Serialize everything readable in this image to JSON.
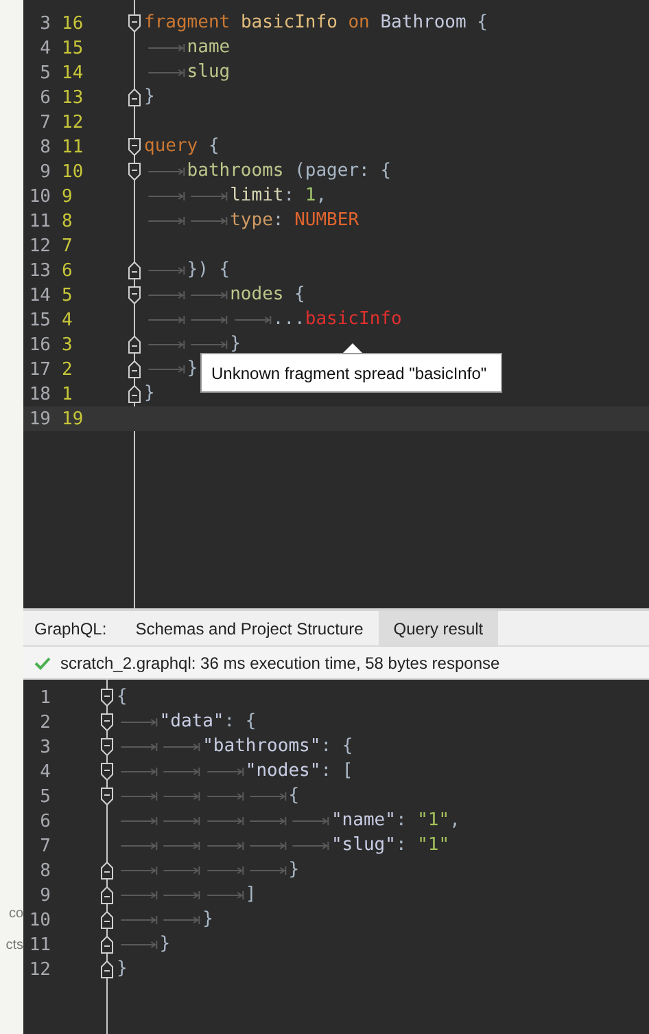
{
  "background_window": {
    "texts": [
      "co",
      "cts"
    ]
  },
  "query_editor": {
    "lines": [
      {
        "numbers": [
          "3",
          "16"
        ],
        "fold_start": true,
        "fold_end": false,
        "tokens": [
          {
            "kind": "keyword",
            "text": "fragment"
          },
          {
            "kind": "definition",
            "text": " basicInfo"
          },
          {
            "kind": "keyword",
            "text": " on"
          },
          {
            "kind": "type",
            "text": " Bathroom"
          },
          {
            "kind": "punct",
            "text": " {"
          }
        ]
      },
      {
        "numbers": [
          "4",
          "15"
        ],
        "fold_start": false,
        "fold_end": false,
        "tokens": [
          {
            "kind": "tab"
          },
          {
            "kind": "field",
            "text": "name"
          }
        ]
      },
      {
        "numbers": [
          "5",
          "14"
        ],
        "fold_start": false,
        "fold_end": false,
        "tokens": [
          {
            "kind": "tab"
          },
          {
            "kind": "field",
            "text": "slug"
          }
        ]
      },
      {
        "numbers": [
          "6",
          "13"
        ],
        "fold_start": false,
        "fold_end": true,
        "tokens": [
          {
            "kind": "punct",
            "text": "}"
          }
        ]
      },
      {
        "numbers": [
          "7",
          "12"
        ],
        "fold_start": false,
        "fold_end": false
      },
      {
        "numbers": [
          "8",
          "11"
        ],
        "fold_start": true,
        "fold_end": false,
        "tokens": [
          {
            "kind": "keyword",
            "text": "query"
          },
          {
            "kind": "punct",
            "text": " {"
          }
        ]
      },
      {
        "numbers": [
          "9",
          "10"
        ],
        "fold_start": true,
        "fold_end": false,
        "tokens": [
          {
            "kind": "tab"
          },
          {
            "kind": "field",
            "text": "bathrooms"
          },
          {
            "kind": "punct",
            "text": " (pager: {"
          }
        ]
      },
      {
        "numbers": [
          "10",
          "9"
        ],
        "fold_start": false,
        "fold_end": false,
        "tokens": [
          {
            "kind": "tab"
          },
          {
            "kind": "tab"
          },
          {
            "kind": "argument",
            "text": "limit"
          },
          {
            "kind": "punct",
            "text": ": "
          },
          {
            "kind": "number",
            "text": "1"
          },
          {
            "kind": "punct",
            "text": ","
          }
        ]
      },
      {
        "numbers": [
          "11",
          "8"
        ],
        "fold_start": false,
        "fold_end": false,
        "tokens": [
          {
            "kind": "tab"
          },
          {
            "kind": "tab"
          },
          {
            "kind": "argument2",
            "text": "type"
          },
          {
            "kind": "punct",
            "text": ": "
          },
          {
            "kind": "enum",
            "text": "NUMBER"
          }
        ]
      },
      {
        "numbers": [
          "12",
          "7"
        ],
        "fold_start": false,
        "fold_end": false
      },
      {
        "numbers": [
          "13",
          "6"
        ],
        "fold_start": false,
        "fold_end": true,
        "tokens": [
          {
            "kind": "tab"
          },
          {
            "kind": "punct",
            "text": "}) {"
          }
        ]
      },
      {
        "numbers": [
          "14",
          "5"
        ],
        "fold_start": true,
        "fold_end": false,
        "tokens": [
          {
            "kind": "tab"
          },
          {
            "kind": "tab"
          },
          {
            "kind": "field",
            "text": "nodes"
          },
          {
            "kind": "punct",
            "text": " {"
          }
        ]
      },
      {
        "numbers": [
          "15",
          "4"
        ],
        "fold_start": false,
        "fold_end": false,
        "tokens": [
          {
            "kind": "tab"
          },
          {
            "kind": "tab"
          },
          {
            "kind": "tab"
          },
          {
            "kind": "punct",
            "text": "..."
          },
          {
            "kind": "error",
            "text": "basicInfo"
          }
        ]
      },
      {
        "numbers": [
          "16",
          "3"
        ],
        "fold_start": false,
        "fold_end": true,
        "tokens": [
          {
            "kind": "tab"
          },
          {
            "kind": "tab"
          },
          {
            "kind": "punct",
            "text": "}"
          }
        ]
      },
      {
        "numbers": [
          "17",
          "2"
        ],
        "fold_start": false,
        "fold_end": true,
        "tokens": [
          {
            "kind": "tab"
          },
          {
            "kind": "punct",
            "text": "}"
          }
        ]
      },
      {
        "numbers": [
          "18",
          "1"
        ],
        "fold_start": false,
        "fold_end": true,
        "tokens": [
          {
            "kind": "punct",
            "text": "}"
          }
        ]
      },
      {
        "numbers": [
          "19",
          "19"
        ],
        "fold_start": false,
        "fold_end": false,
        "current": true
      }
    ],
    "tooltip": "Unknown fragment spread \"basicInfo\""
  },
  "tool_window": {
    "label": "GraphQL:",
    "tabs": [
      {
        "label": "Schemas and Project Structure",
        "selected": false
      },
      {
        "label": "Query result",
        "selected": true
      }
    ],
    "status": {
      "ok": true,
      "text": "scratch_2.graphql: 36 ms execution time, 58 bytes response"
    }
  },
  "result_editor": {
    "lines": [
      {
        "number": "1",
        "fold_start": true,
        "fold_end": false,
        "tokens": [
          {
            "kind": "punct",
            "text": "{"
          }
        ]
      },
      {
        "number": "2",
        "fold_start": true,
        "fold_end": false,
        "tokens": [
          {
            "kind": "tab"
          },
          {
            "kind": "key",
            "text": "\"data\""
          },
          {
            "kind": "punct",
            "text": ": {"
          }
        ]
      },
      {
        "number": "3",
        "fold_start": true,
        "fold_end": false,
        "tokens": [
          {
            "kind": "tab"
          },
          {
            "kind": "tab"
          },
          {
            "kind": "key",
            "text": "\"bathrooms\""
          },
          {
            "kind": "punct",
            "text": ": {"
          }
        ]
      },
      {
        "number": "4",
        "fold_start": true,
        "fold_end": false,
        "tokens": [
          {
            "kind": "tab"
          },
          {
            "kind": "tab"
          },
          {
            "kind": "tab"
          },
          {
            "kind": "key",
            "text": "\"nodes\""
          },
          {
            "kind": "punct",
            "text": ": ["
          }
        ]
      },
      {
        "number": "5",
        "fold_start": true,
        "fold_end": false,
        "tokens": [
          {
            "kind": "tab"
          },
          {
            "kind": "tab"
          },
          {
            "kind": "tab"
          },
          {
            "kind": "tab"
          },
          {
            "kind": "punct",
            "text": "{"
          }
        ]
      },
      {
        "number": "6",
        "fold_start": false,
        "fold_end": false,
        "tokens": [
          {
            "kind": "tab"
          },
          {
            "kind": "tab"
          },
          {
            "kind": "tab"
          },
          {
            "kind": "tab"
          },
          {
            "kind": "tab"
          },
          {
            "kind": "key",
            "text": "\"name\""
          },
          {
            "kind": "punct",
            "text": ": "
          },
          {
            "kind": "string",
            "text": "\"1\""
          },
          {
            "kind": "punct",
            "text": ","
          }
        ]
      },
      {
        "number": "7",
        "fold_start": false,
        "fold_end": false,
        "tokens": [
          {
            "kind": "tab"
          },
          {
            "kind": "tab"
          },
          {
            "kind": "tab"
          },
          {
            "kind": "tab"
          },
          {
            "kind": "tab"
          },
          {
            "kind": "key",
            "text": "\"slug\""
          },
          {
            "kind": "punct",
            "text": ": "
          },
          {
            "kind": "string",
            "text": "\"1\""
          }
        ]
      },
      {
        "number": "8",
        "fold_start": false,
        "fold_end": true,
        "tokens": [
          {
            "kind": "tab"
          },
          {
            "kind": "tab"
          },
          {
            "kind": "tab"
          },
          {
            "kind": "tab"
          },
          {
            "kind": "punct",
            "text": "}"
          }
        ]
      },
      {
        "number": "9",
        "fold_start": false,
        "fold_end": true,
        "tokens": [
          {
            "kind": "tab"
          },
          {
            "kind": "tab"
          },
          {
            "kind": "tab"
          },
          {
            "kind": "punct",
            "text": "]"
          }
        ]
      },
      {
        "number": "10",
        "fold_start": false,
        "fold_end": true,
        "tokens": [
          {
            "kind": "tab"
          },
          {
            "kind": "tab"
          },
          {
            "kind": "punct",
            "text": "}"
          }
        ]
      },
      {
        "number": "11",
        "fold_start": false,
        "fold_end": true,
        "tokens": [
          {
            "kind": "tab"
          },
          {
            "kind": "punct",
            "text": "}"
          }
        ]
      },
      {
        "number": "12",
        "fold_start": false,
        "fold_end": true,
        "tokens": [
          {
            "kind": "punct",
            "text": "}"
          }
        ]
      }
    ]
  }
}
